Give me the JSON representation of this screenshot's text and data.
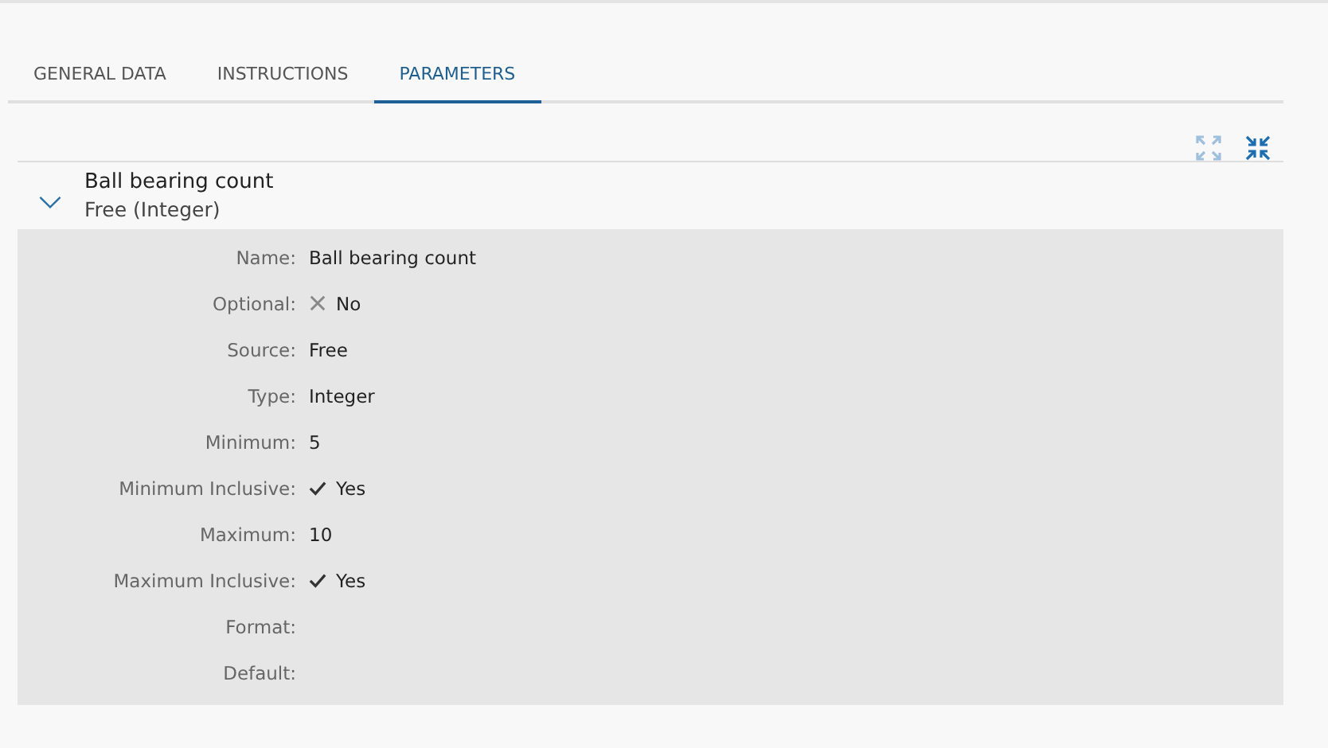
{
  "tabs": [
    {
      "label": "GENERAL DATA",
      "selected": false
    },
    {
      "label": "INSTRUCTIONS",
      "selected": false
    },
    {
      "label": "PARAMETERS",
      "selected": true
    }
  ],
  "toolbar": [
    {
      "kind": "expand",
      "disabled": true
    },
    {
      "kind": "collapse",
      "disabled": false
    }
  ],
  "parameter": {
    "title": "Ball bearing count",
    "subtitle": "Free (Integer)",
    "expanded": true,
    "fields": [
      {
        "label": "Name:",
        "kind": "text",
        "value": "Ball bearing count"
      },
      {
        "label": "Optional:",
        "kind": "boolean",
        "checked": false,
        "value": "No"
      },
      {
        "label": "Source:",
        "kind": "text",
        "value": "Free"
      },
      {
        "label": "Type:",
        "kind": "text",
        "value": "Integer"
      },
      {
        "label": "Minimum:",
        "kind": "text",
        "value": "5"
      },
      {
        "label": "Minimum Inclusive:",
        "kind": "boolean",
        "checked": true,
        "value": "Yes"
      },
      {
        "label": "Maximum:",
        "kind": "text",
        "value": "10"
      },
      {
        "label": "Maximum Inclusive:",
        "kind": "boolean",
        "checked": true,
        "value": "Yes"
      },
      {
        "label": "Format:",
        "kind": "empty"
      },
      {
        "label": "Default:",
        "kind": "empty"
      }
    ]
  }
}
